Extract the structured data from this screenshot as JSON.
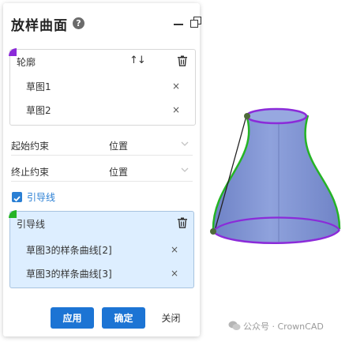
{
  "dialog": {
    "title": "放样曲面",
    "help_glyph": "?"
  },
  "profile": {
    "title": "轮廓",
    "sort_glyph": "↑↓",
    "items": [
      {
        "label": "草图1"
      },
      {
        "label": "草图2"
      }
    ],
    "accent_color": "#8b2bd9"
  },
  "start_constraint": {
    "label": "起始约束",
    "value": "位置"
  },
  "end_constraint": {
    "label": "终止约束",
    "value": "位置"
  },
  "guide_checkbox": {
    "label": "引导线",
    "checked": true
  },
  "guide": {
    "title": "引导线",
    "items": [
      {
        "label": "草图3的样条曲线[2]"
      },
      {
        "label": "草图3的样条曲线[3]"
      }
    ],
    "accent_color": "#25b425"
  },
  "buttons": {
    "apply": "应用",
    "ok": "确定",
    "close": "关闭"
  },
  "remove_glyph": "×",
  "watermark": {
    "text": "公众号 · CrownCAD"
  },
  "colors": {
    "primary": "#1c74d4",
    "surface_fill": "#7f92cf",
    "profile_curve": "#8b2bd9",
    "guide_curve": "#25b425"
  }
}
